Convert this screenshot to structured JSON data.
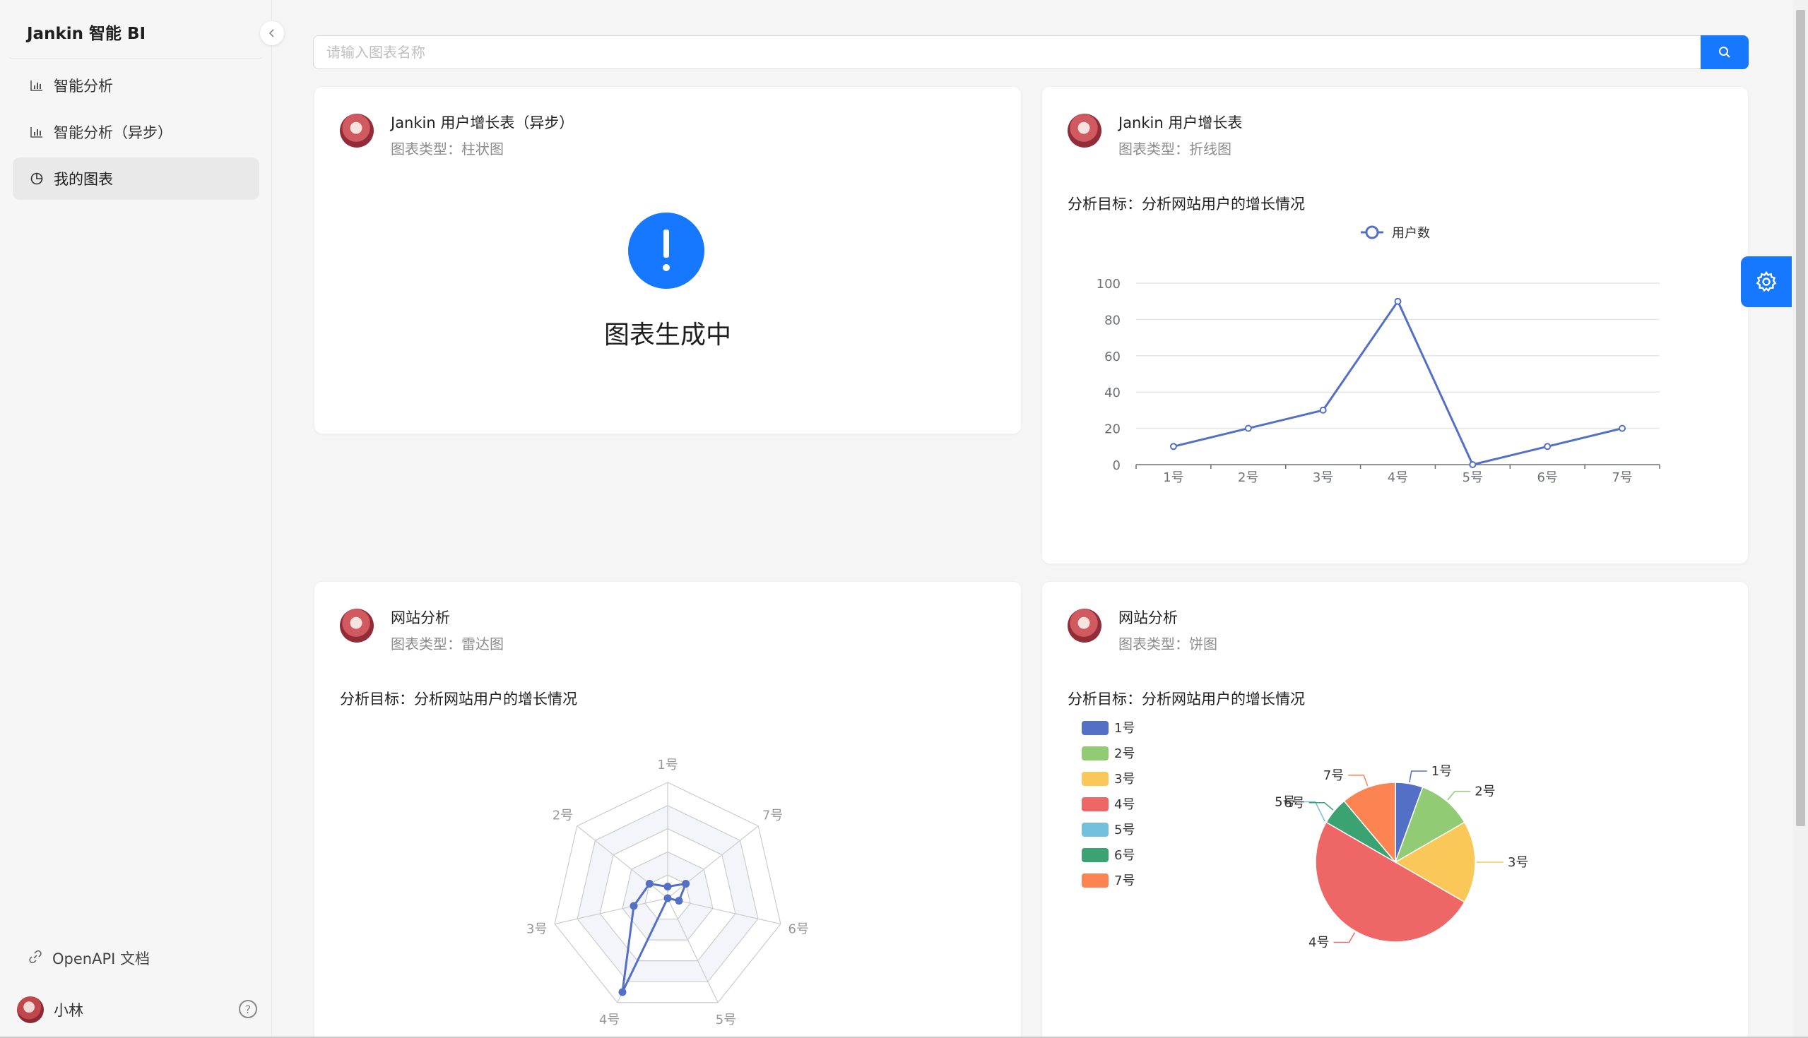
{
  "app": {
    "title": "Jankin 智能 BI"
  },
  "sidebar": {
    "items": [
      {
        "label": "智能分析",
        "icon": "bar-chart-icon"
      },
      {
        "label": "智能分析（异步）",
        "icon": "bar-chart-icon"
      },
      {
        "label": "我的图表",
        "icon": "pie-chart-icon",
        "active": true
      }
    ],
    "openapi_label": "OpenAPI 文档",
    "user_name": "小林"
  },
  "search": {
    "placeholder": "请输入图表名称",
    "value": ""
  },
  "colors": {
    "primary": "#1677ff",
    "line": "#5470c6"
  },
  "cards": [
    {
      "title": "Jankin 用户增长表（异步）",
      "type_label": "图表类型：柱状图",
      "status_text": "图表生成中"
    },
    {
      "title": "Jankin 用户增长表",
      "type_label": "图表类型：折线图",
      "goal": "分析目标：分析网站用户的增长情况"
    },
    {
      "title": "网站分析",
      "type_label": "图表类型：雷达图",
      "goal": "分析目标：分析网站用户的增长情况"
    },
    {
      "title": "网站分析",
      "type_label": "图表类型：饼图",
      "goal": "分析目标：分析网站用户的增长情况"
    }
  ],
  "chart_data": [
    {
      "type": "line",
      "legend": [
        "用户数"
      ],
      "categories": [
        "1号",
        "2号",
        "3号",
        "4号",
        "5号",
        "6号",
        "7号"
      ],
      "series": [
        {
          "name": "用户数",
          "values": [
            10,
            20,
            30,
            90,
            0,
            10,
            20
          ]
        }
      ],
      "yticks": [
        "0",
        "20",
        "40",
        "60",
        "80",
        "100"
      ],
      "ylim": [
        0,
        100
      ],
      "grid": true
    },
    {
      "type": "radar",
      "indicators": [
        "1号",
        "7号",
        "6号",
        "5号",
        "4号",
        "3号",
        "2号"
      ],
      "max": 100,
      "series": [
        {
          "values": [
            10,
            20,
            10,
            0,
            90,
            30,
            20
          ]
        }
      ]
    },
    {
      "type": "pie",
      "categories": [
        "1号",
        "2号",
        "3号",
        "4号",
        "5号",
        "6号",
        "7号"
      ],
      "values": [
        10,
        20,
        30,
        90,
        0,
        10,
        20
      ],
      "colors": [
        "#5470c6",
        "#91cc75",
        "#fac858",
        "#ee6666",
        "#73c0de",
        "#3ba272",
        "#fc8452"
      ],
      "legend_position": "top-left"
    }
  ]
}
